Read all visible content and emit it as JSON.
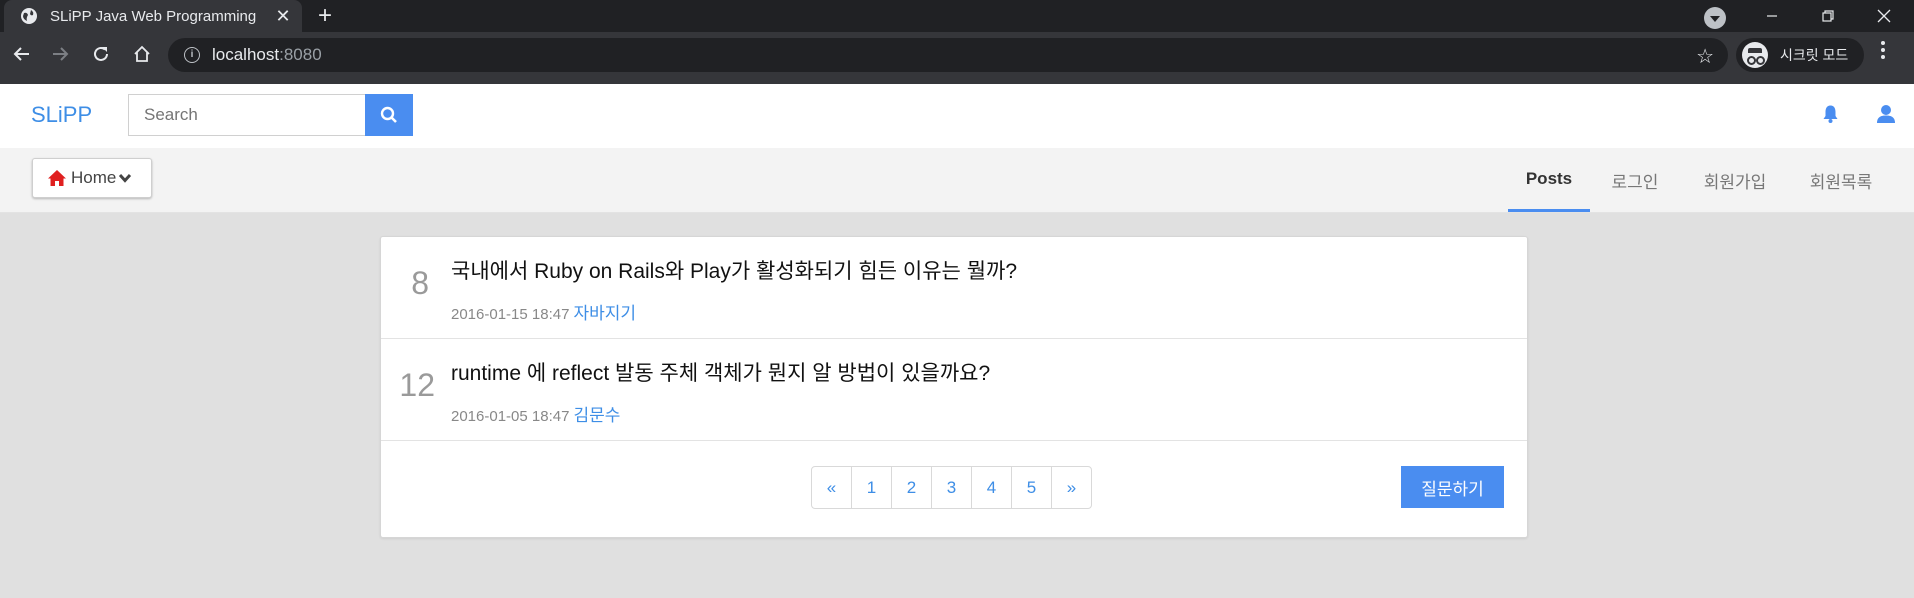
{
  "browser": {
    "tab_title": "SLiPP Java Web Programming",
    "tab_close": "✕",
    "new_tab": "+",
    "url_host": "localhost",
    "url_port": ":8080",
    "incognito_label": "시크릿 모드",
    "colors": {
      "chrome_dark": "#202124",
      "chrome_tab": "#35363a"
    }
  },
  "header": {
    "brand": "SLiPP",
    "search_placeholder": "Search",
    "accent": "#4a8df0"
  },
  "subnav": {
    "home_label": "Home",
    "links": [
      {
        "label": "Posts",
        "active": true
      },
      {
        "label": "로그인"
      },
      {
        "label": "회원가입"
      },
      {
        "label": "회원목록"
      }
    ]
  },
  "posts": [
    {
      "count": "8",
      "title": "국내에서 Ruby on Rails와 Play가 활성화되기 힘든 이유는 뭘까?",
      "date": "2016-01-15 18:47",
      "author": "자바지기"
    },
    {
      "count": "12",
      "title": "runtime 에 reflect 발동 주체 객체가 뭔지 알 방법이 있을까요?",
      "date": "2016-01-05 18:47",
      "author": "김문수"
    }
  ],
  "pagination": [
    "«",
    "1",
    "2",
    "3",
    "4",
    "5",
    "»"
  ],
  "ask_button": "질문하기"
}
